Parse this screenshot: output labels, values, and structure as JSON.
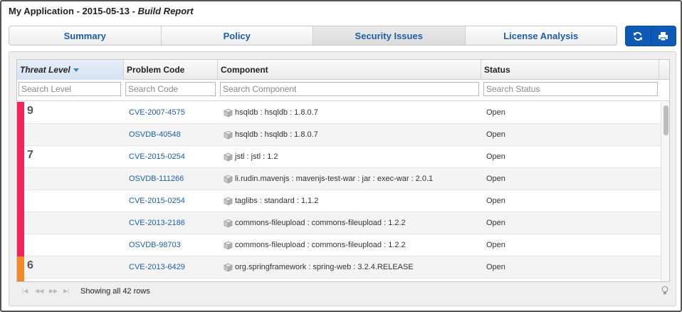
{
  "app": {
    "title": "My Application - 2015-05-13 - ",
    "subtitle": "Build Report"
  },
  "tabs": [
    {
      "label": "Summary",
      "active": false
    },
    {
      "label": "Policy",
      "active": false
    },
    {
      "label": "Security Issues",
      "active": true
    },
    {
      "label": "License Analysis",
      "active": false
    }
  ],
  "actions": {
    "refresh_icon": "refresh-icon",
    "print_icon": "print-icon",
    "accent": "#0d5ab7"
  },
  "grid": {
    "columns": [
      {
        "label": "Threat Level",
        "sorted": "desc"
      },
      {
        "label": "Problem Code"
      },
      {
        "label": "Component"
      },
      {
        "label": "Status"
      }
    ],
    "filters": {
      "level": "Search Level",
      "code": "Search Code",
      "component": "Search Component",
      "status": "Search Status"
    },
    "colors": {
      "critical": "#f0245a",
      "severe": "#f28a25"
    },
    "rows": [
      {
        "level": "9",
        "severity": "critical",
        "code": "CVE-2007-4575",
        "component": "hsqldb : hsqldb : 1.8.0.7",
        "status": "Open"
      },
      {
        "level": "",
        "severity": "critical",
        "code": "OSVDB-40548",
        "component": "hsqldb : hsqldb : 1.8.0.7",
        "status": "Open"
      },
      {
        "level": "7",
        "severity": "critical",
        "code": "CVE-2015-0254",
        "component": "jstl : jstl : 1.2",
        "status": "Open"
      },
      {
        "level": "",
        "severity": "critical",
        "code": "OSVDB-111266",
        "component": "li.rudin.mavenjs : mavenjs-test-war : jar : exec-war : 2.0.1",
        "status": "Open"
      },
      {
        "level": "",
        "severity": "critical",
        "code": "CVE-2015-0254",
        "component": "taglibs : standard : 1.1.2",
        "status": "Open"
      },
      {
        "level": "",
        "severity": "critical",
        "code": "CVE-2013-2186",
        "component": "commons-fileupload : commons-fileupload : 1.2.2",
        "status": "Open"
      },
      {
        "level": "",
        "severity": "critical",
        "code": "OSVDB-98703",
        "component": "commons-fileupload : commons-fileupload : 1.2.2",
        "status": "Open"
      },
      {
        "level": "6",
        "severity": "severe",
        "code": "CVE-2013-6429",
        "component": "org.springframework : spring-web : 3.2.4.RELEASE",
        "status": "Open"
      },
      {
        "level": "",
        "severity": "severe",
        "code": "",
        "component": "",
        "status": ""
      }
    ],
    "footer": {
      "showing": "Showing all 42 rows",
      "hint_icon": "lightbulb-icon"
    }
  }
}
